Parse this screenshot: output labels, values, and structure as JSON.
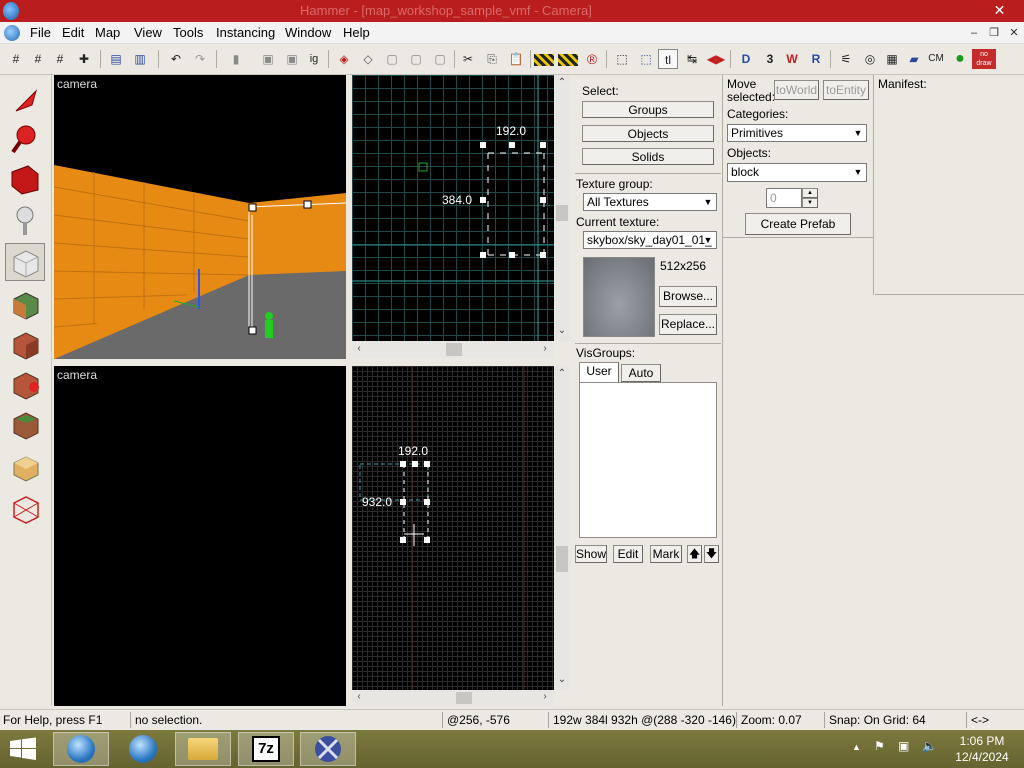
{
  "window": {
    "title": "Hammer - [map_workshop_sample_vmf - Camera]",
    "close_glyph": "✕"
  },
  "menu": [
    "File",
    "Edit",
    "Map",
    "View",
    "Tools",
    "Instancing",
    "Window",
    "Help"
  ],
  "toolbar": {
    "undo": "↶",
    "redo": "↷",
    "cut": "✂",
    "tl": "tl",
    "cm": "CM",
    "nodraw": "no draw"
  },
  "viewports": {
    "top_left": {
      "label": "camera"
    },
    "bottom_left": {
      "label": "camera"
    },
    "top_right": {
      "dim_top": "192.0",
      "dim_side": "384.0"
    },
    "bottom_right": {
      "dim_top": "192.0",
      "dim_side": "932.0"
    }
  },
  "select_panel": {
    "label": "Select:",
    "groups": "Groups",
    "objects": "Objects",
    "solids": "Solids"
  },
  "texture": {
    "group_label": "Texture group:",
    "group_value": "All Textures",
    "current_label": "Current texture:",
    "current_value": "skybox/sky_day01_01_",
    "size": "512x256",
    "browse": "Browse...",
    "replace": "Replace..."
  },
  "visgroups": {
    "label": "VisGroups:",
    "tabs": [
      "User",
      "Auto"
    ],
    "show": "Show",
    "edit": "Edit",
    "mark": "Mark",
    "up": "🡅",
    "down": "🡇"
  },
  "move": {
    "label_line1": "Move",
    "label_line2": "selected:",
    "to_world": "toWorld",
    "to_entity": "toEntity",
    "categories_label": "Categories:",
    "categories_value": "Primitives",
    "objects_label": "Objects:",
    "objects_value": "block",
    "count": "0",
    "create_prefab": "Create Prefab"
  },
  "manifest": {
    "label": "Manifest:"
  },
  "status": {
    "help": "For Help, press F1",
    "selection": "no selection.",
    "coords": "@256, -576",
    "size": "192w 384l 932h @(288 -320 -146)",
    "zoom": "Zoom: 0.07",
    "snap": "Snap: On Grid: 64",
    "arrows": "<->"
  },
  "taskbar": {
    "time": "1:06 PM",
    "date": "12/4/2024",
    "app_7z": "7z"
  },
  "colors": {
    "titlebar": "#b91d1d",
    "wall": "#e68a14",
    "floor": "#6c6c6c",
    "grid_line": "#2a5a5a",
    "taskbar": "#716f36"
  }
}
